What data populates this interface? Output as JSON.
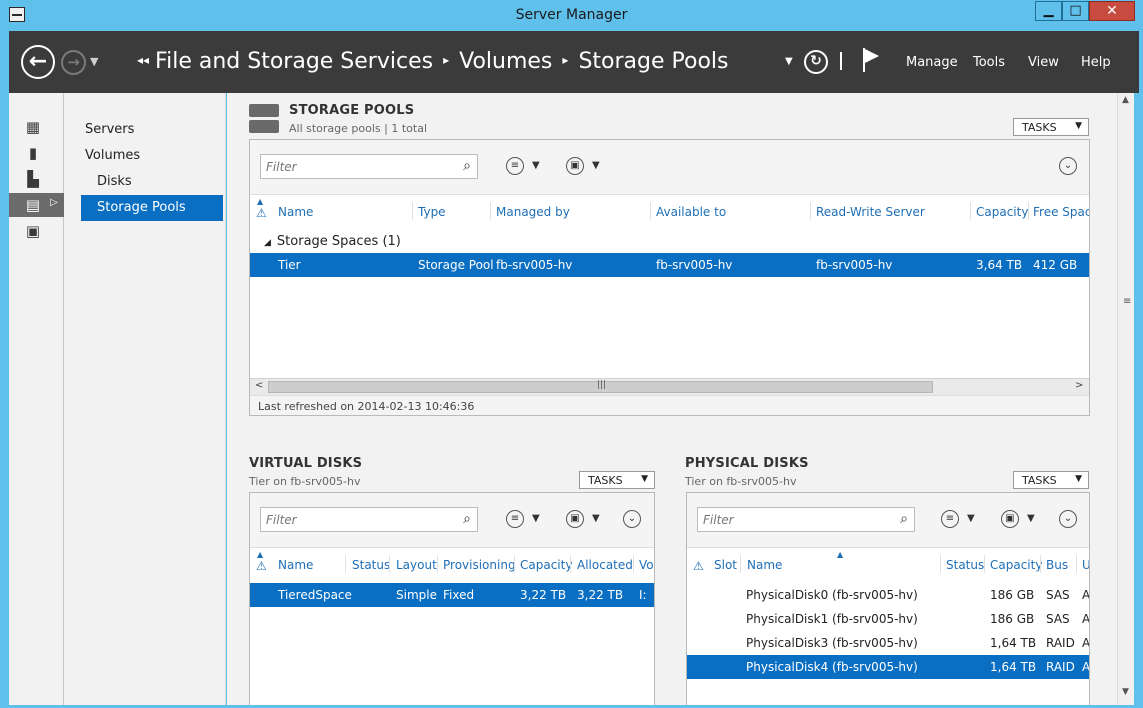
{
  "window": {
    "title": "Server Manager"
  },
  "header": {
    "crumbs": [
      "File and Storage Services",
      "Volumes",
      "Storage Pools"
    ],
    "menus": [
      "Manage",
      "Tools",
      "View",
      "Help"
    ]
  },
  "nav": {
    "items": [
      "Servers",
      "Volumes",
      "Disks",
      "Storage Pools"
    ]
  },
  "storage_pools": {
    "title": "STORAGE POOLS",
    "subtitle": "All storage pools | 1 total",
    "tasks": "TASKS",
    "filter_placeholder": "Filter",
    "columns": [
      "Name",
      "Type",
      "Managed by",
      "Available to",
      "Read-Write Server",
      "Capacity",
      "Free Space"
    ],
    "group": "Storage Spaces (1)",
    "rows": [
      {
        "name": "Tier",
        "type": "Storage Pool",
        "managed_by": "fb-srv005-hv",
        "available_to": "fb-srv005-hv",
        "rw_server": "fb-srv005-hv",
        "capacity": "3,64 TB",
        "free_space": "412 GB"
      }
    ],
    "last_refreshed": "Last refreshed on 2014-02-13 10:46:36"
  },
  "virtual_disks": {
    "title": "VIRTUAL DISKS",
    "subtitle": "Tier on fb-srv005-hv",
    "tasks": "TASKS",
    "filter_placeholder": "Filter",
    "columns": [
      "Name",
      "Status",
      "Layout",
      "Provisioning",
      "Capacity",
      "Allocated",
      "Vo"
    ],
    "rows": [
      {
        "name": "TieredSpace",
        "status": "",
        "layout": "Simple",
        "provisioning": "Fixed",
        "capacity": "3,22 TB",
        "allocated": "3,22 TB",
        "vo": "I:"
      }
    ]
  },
  "physical_disks": {
    "title": "PHYSICAL DISKS",
    "subtitle": "Tier on fb-srv005-hv",
    "tasks": "TASKS",
    "filter_placeholder": "Filter",
    "columns": [
      "Slot",
      "Name",
      "Status",
      "Capacity",
      "Bus",
      "U"
    ],
    "rows": [
      {
        "name": "PhysicalDisk0 (fb-srv005-hv)",
        "capacity": "186 GB",
        "bus": "SAS",
        "u": "A",
        "selected": false
      },
      {
        "name": "PhysicalDisk1 (fb-srv005-hv)",
        "capacity": "186 GB",
        "bus": "SAS",
        "u": "A",
        "selected": false
      },
      {
        "name": "PhysicalDisk3 (fb-srv005-hv)",
        "capacity": "1,64 TB",
        "bus": "RAID",
        "u": "A",
        "selected": false
      },
      {
        "name": "PhysicalDisk4 (fb-srv005-hv)",
        "capacity": "1,64 TB",
        "bus": "RAID",
        "u": "A",
        "selected": true
      }
    ]
  },
  "icons": {
    "back": "back-arrow-icon",
    "forward": "forward-arrow-icon",
    "refresh": "refresh-icon",
    "flag": "notification-flag-icon",
    "search": "search-icon",
    "list": "list-view-icon",
    "save": "save-icon",
    "expand": "expand-chevron-icon",
    "warning": "warning-icon"
  },
  "colors": {
    "accent": "#0a6fc2",
    "header": "#3b3b3b",
    "window": "#5fc0ec",
    "close": "#c74b3f"
  }
}
